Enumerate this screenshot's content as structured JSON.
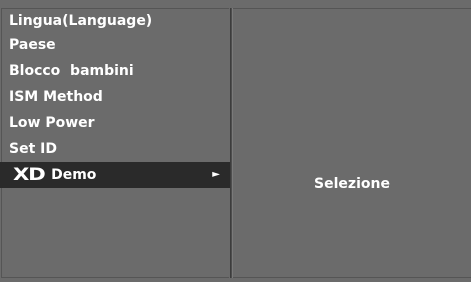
{
  "menu": {
    "items": [
      {
        "label": "Lingua(Language)"
      },
      {
        "label": "Paese"
      },
      {
        "label": "Blocco  bambini"
      },
      {
        "label": "ISM Method"
      },
      {
        "label": "Low Power"
      },
      {
        "label": "Set ID"
      },
      {
        "logo": "XD",
        "label": "Demo",
        "selected": true,
        "arrow": "►"
      }
    ]
  },
  "panel": {
    "text": "Selezione"
  },
  "colors": {
    "background": "#6b6b6b",
    "highlight": "#2a2a2a",
    "text": "#ffffff"
  }
}
